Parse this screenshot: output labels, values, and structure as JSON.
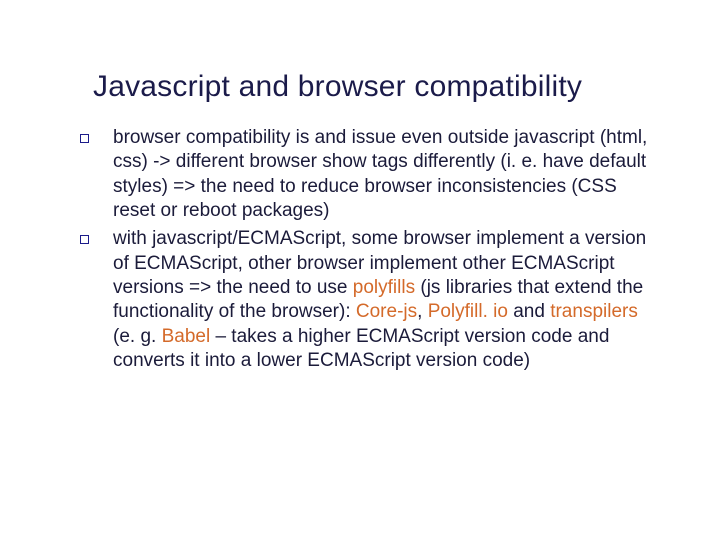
{
  "title": "Javascript and browser compatibility",
  "bullets": [
    {
      "runs": [
        {
          "t": "browser compatibility is and issue even outside javascript (html, css) -> different browser show tags differently (i. e. have default styles) => the need to reduce browser inconsistencies (CSS reset or reboot packages)",
          "hl": false
        }
      ]
    },
    {
      "runs": [
        {
          "t": "with javascript/ECMAScript, some browser implement a version of ECMAScript, other browser implement other ECMAScript versions => the need to use ",
          "hl": false
        },
        {
          "t": "polyfills",
          "hl": true
        },
        {
          "t": " (js libraries that extend the functionality of the browser): ",
          "hl": false
        },
        {
          "t": "Core-js",
          "hl": true
        },
        {
          "t": ", ",
          "hl": false
        },
        {
          "t": "Polyfill. io ",
          "hl": true
        },
        {
          "t": "and ",
          "hl": false
        },
        {
          "t": "transpilers",
          "hl": true
        },
        {
          "t": " (e. g. ",
          "hl": false
        },
        {
          "t": "Babel",
          "hl": true
        },
        {
          "t": " – takes a higher ECMAScript version code and converts it into a lower ECMAScript version code)",
          "hl": false
        }
      ]
    }
  ]
}
